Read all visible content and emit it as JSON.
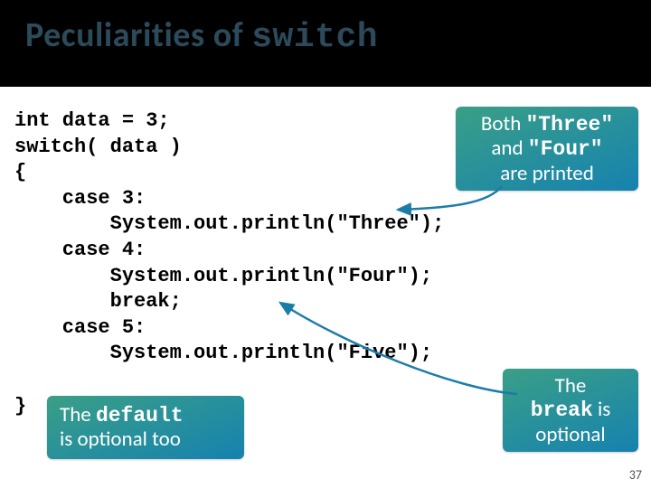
{
  "title": {
    "prefix": "Peculiarities of ",
    "mono": "switch"
  },
  "code": {
    "l1": "int data = 3;",
    "l2": "switch( data )",
    "l3": "{",
    "l4": "    case 3:",
    "l5": "        System.out.println(\"Three\");",
    "l6": "    case 4:",
    "l7": "        System.out.println(\"Four\");",
    "l8": "        break;",
    "l9": "    case 5:",
    "l10": "        System.out.println(\"Five\");",
    "l11": "}"
  },
  "callouts": {
    "three_four": {
      "t1": "Both ",
      "m1": "\"Three\"",
      "t2": " and ",
      "m2": "\"Four\"",
      "t3": " are printed"
    },
    "break_opt": {
      "t1": "The ",
      "m1": "break",
      "t2": " is optional"
    },
    "default_opt": {
      "t1": "The ",
      "m1": "default",
      "t2": " is optional too"
    }
  },
  "pagenum": "37"
}
